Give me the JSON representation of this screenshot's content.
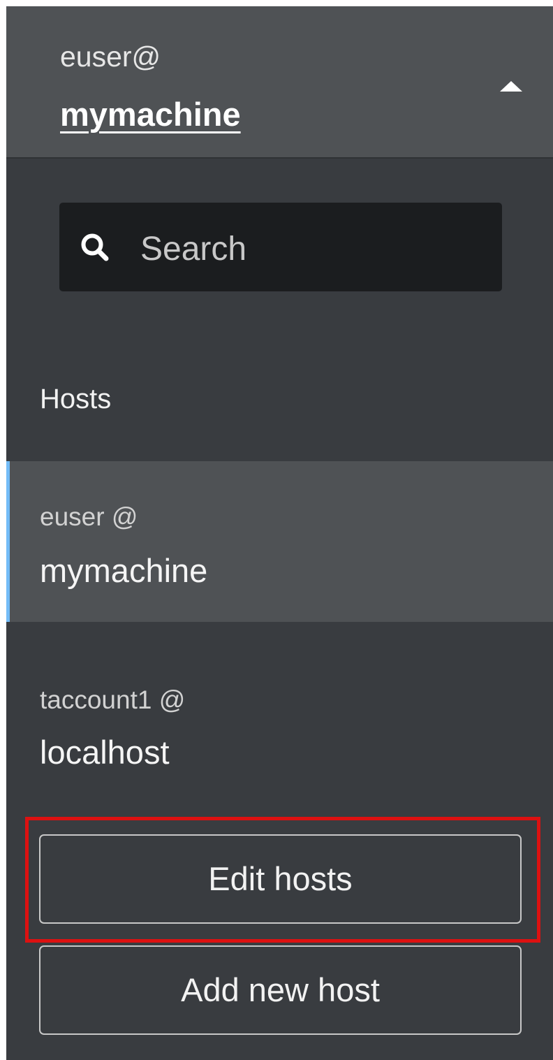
{
  "header": {
    "user": "euser@",
    "host": "mymachine",
    "toggle_icon": "caret-up-icon"
  },
  "search": {
    "placeholder": "Search",
    "icon": "search-icon"
  },
  "hosts_section": {
    "title": "Hosts",
    "items": [
      {
        "user": "euser @",
        "host": "mymachine",
        "active": true
      },
      {
        "user": "taccount1 @",
        "host": "localhost",
        "active": false
      }
    ]
  },
  "buttons": {
    "edit_hosts": "Edit hosts",
    "add_new_host": "Add new host"
  },
  "colors": {
    "panel_bg": "#393c40",
    "header_bg": "#4f5255",
    "active_item_bg": "#4f5255",
    "active_indicator": "#73bcf7",
    "search_bg": "#1b1d1f",
    "highlight": "#dd1111"
  }
}
